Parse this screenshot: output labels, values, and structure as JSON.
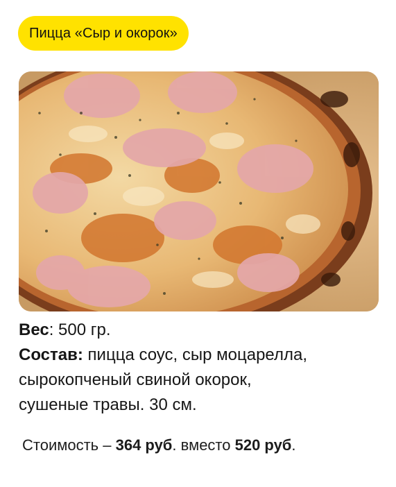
{
  "product": {
    "title": "Пицца «Сыр и окорок»",
    "badge_color": "#FFE200",
    "image_alt": "pizza-photo"
  },
  "details": {
    "weight_label": "Вес",
    "weight_value": ": 500 гр.",
    "composition_label": "Состав:",
    "composition_line1": " пицца соус, сыр моцарелла,",
    "composition_line2": "сырокопченый свиной окорок,",
    "composition_line3": "сушеные травы. 30 см."
  },
  "pricing": {
    "label": "Стоимость  – ",
    "new_price": "364 руб",
    "middle_text": ". вместо ",
    "old_price": "520 руб",
    "end": "."
  }
}
